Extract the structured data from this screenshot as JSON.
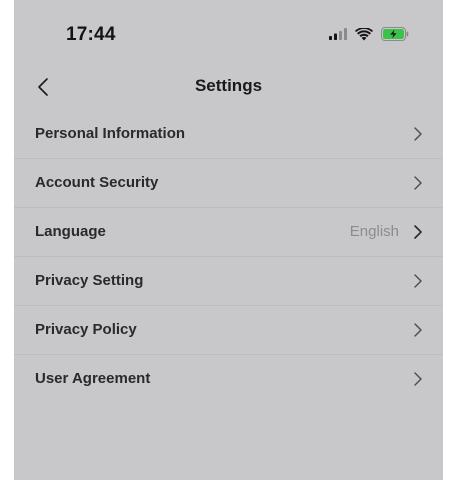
{
  "status_bar": {
    "time": "17:44",
    "icons": [
      "signal-icon",
      "wifi-icon",
      "battery-charging-icon"
    ]
  },
  "nav": {
    "back_icon": "chevron-left-icon",
    "title": "Settings"
  },
  "settings": {
    "items": [
      {
        "label": "Personal Information",
        "value": ""
      },
      {
        "label": "Account Security",
        "value": ""
      },
      {
        "label": "Language",
        "value": "English"
      },
      {
        "label": "Privacy Setting",
        "value": ""
      },
      {
        "label": "Privacy Policy",
        "value": ""
      },
      {
        "label": "User Agreement",
        "value": ""
      }
    ]
  },
  "colors": {
    "screen_background": "#c8c8ca",
    "text_primary": "#2a2a2a",
    "text_secondary": "#8c8c8e",
    "battery_fill": "#3ac24a"
  }
}
